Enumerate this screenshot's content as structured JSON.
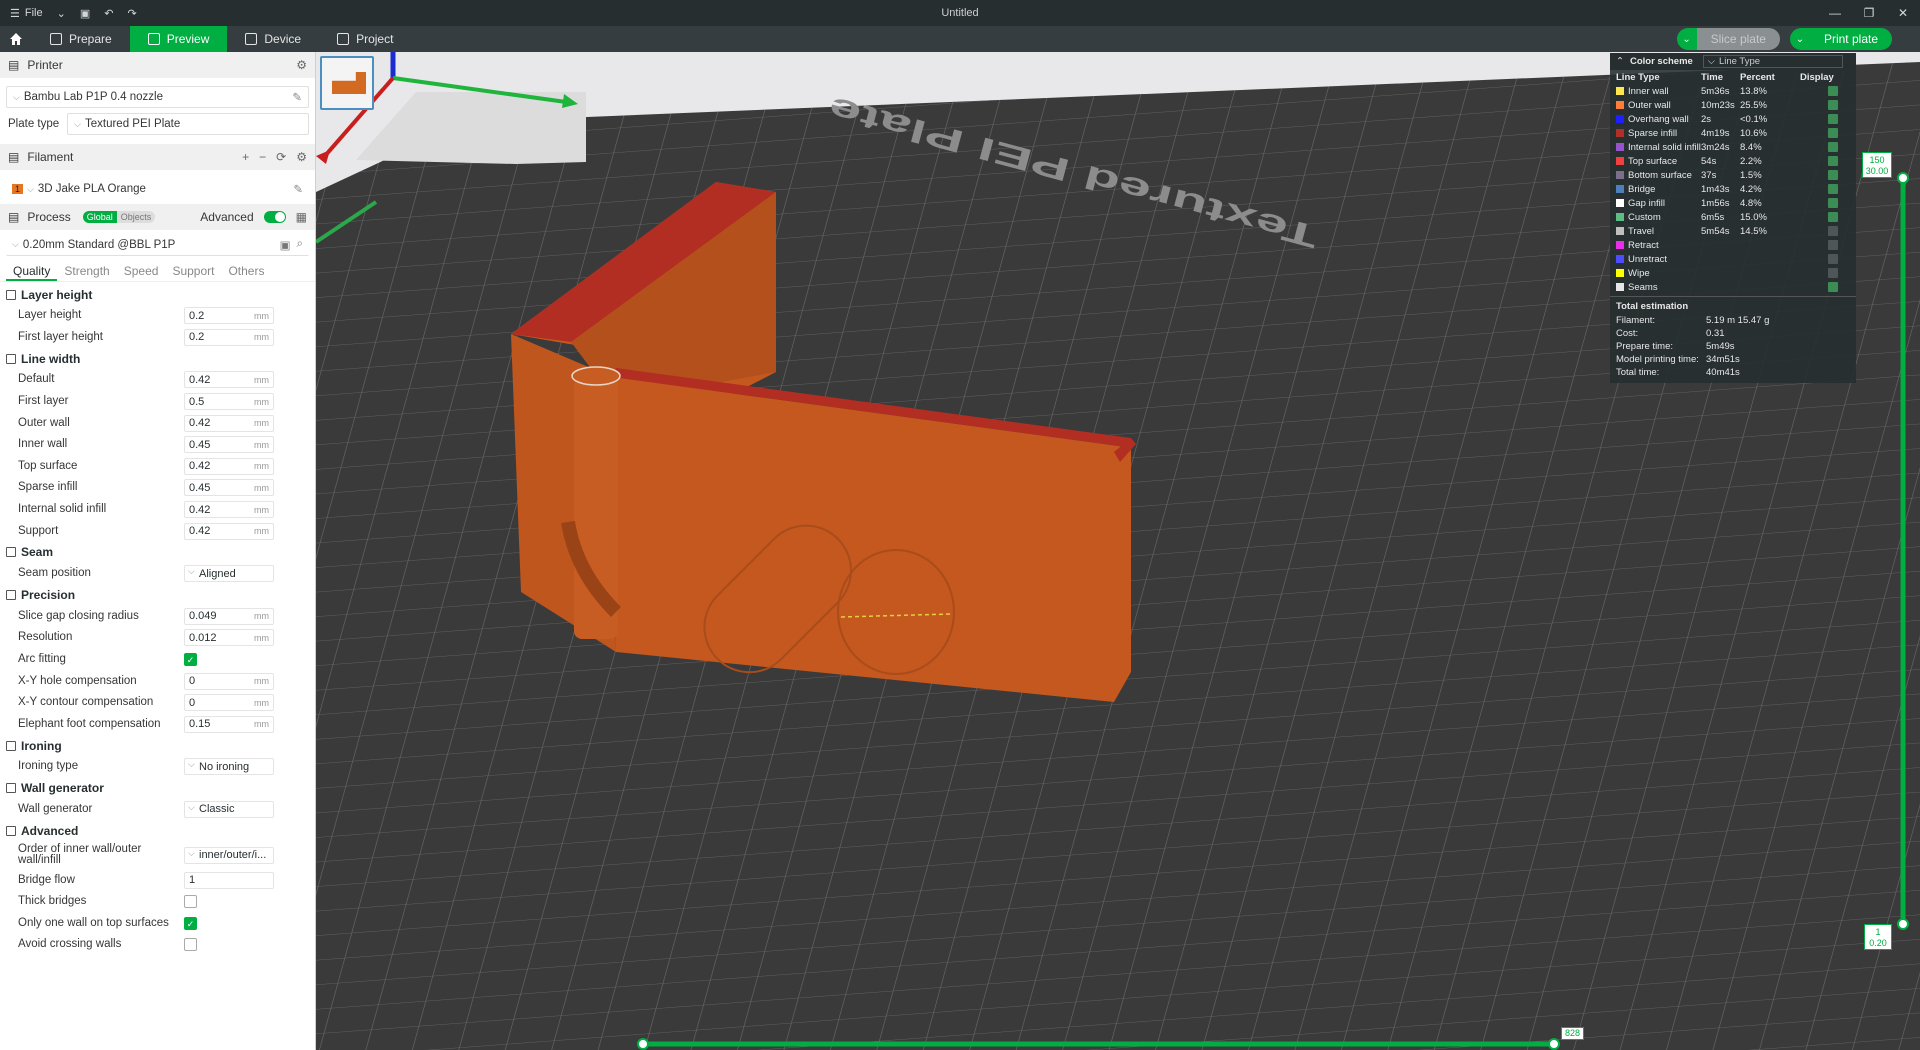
{
  "window": {
    "title": "Untitled",
    "file_label": "File"
  },
  "toolbar": {
    "tabs": [
      {
        "label": "Prepare"
      },
      {
        "label": "Preview"
      },
      {
        "label": "Device"
      },
      {
        "label": "Project"
      }
    ],
    "slice_label": "Slice plate",
    "print_label": "Print plate"
  },
  "printer": {
    "section_label": "Printer",
    "printer_name": "Bambu Lab P1P 0.4 nozzle",
    "plate_type_label": "Plate type",
    "plate_type_value": "Textured PEI Plate"
  },
  "filament": {
    "section_label": "Filament",
    "slot": "1",
    "name": "3D Jake PLA Orange"
  },
  "process": {
    "section_label": "Process",
    "toggle_global": "Global",
    "toggle_objects": "Objects",
    "advanced_label": "Advanced",
    "profile": "0.20mm Standard @BBL P1P",
    "subtabs": [
      "Quality",
      "Strength",
      "Speed",
      "Support",
      "Others"
    ]
  },
  "groups": {
    "layer_height": {
      "title": "Layer height",
      "rows": [
        {
          "label": "Layer height",
          "value": "0.2",
          "unit": "mm"
        },
        {
          "label": "First layer height",
          "value": "0.2",
          "unit": "mm"
        }
      ]
    },
    "line_width": {
      "title": "Line width",
      "rows": [
        {
          "label": "Default",
          "value": "0.42",
          "unit": "mm"
        },
        {
          "label": "First layer",
          "value": "0.5",
          "unit": "mm"
        },
        {
          "label": "Outer wall",
          "value": "0.42",
          "unit": "mm"
        },
        {
          "label": "Inner wall",
          "value": "0.45",
          "unit": "mm"
        },
        {
          "label": "Top surface",
          "value": "0.42",
          "unit": "mm"
        },
        {
          "label": "Sparse infill",
          "value": "0.45",
          "unit": "mm"
        },
        {
          "label": "Internal solid infill",
          "value": "0.42",
          "unit": "mm"
        },
        {
          "label": "Support",
          "value": "0.42",
          "unit": "mm"
        }
      ]
    },
    "seam": {
      "title": "Seam",
      "rows": [
        {
          "label": "Seam position",
          "value": "Aligned"
        }
      ]
    },
    "precision": {
      "title": "Precision",
      "rows": [
        {
          "label": "Slice gap closing radius",
          "value": "0.049",
          "unit": "mm"
        },
        {
          "label": "Resolution",
          "value": "0.012",
          "unit": "mm"
        },
        {
          "label": "Arc fitting",
          "checked": true
        },
        {
          "label": "X-Y hole compensation",
          "value": "0",
          "unit": "mm"
        },
        {
          "label": "X-Y contour compensation",
          "value": "0",
          "unit": "mm"
        },
        {
          "label": "Elephant foot compensation",
          "value": "0.15",
          "unit": "mm"
        }
      ]
    },
    "ironing": {
      "title": "Ironing",
      "rows": [
        {
          "label": "Ironing type",
          "value": "No ironing"
        }
      ]
    },
    "wall_generator": {
      "title": "Wall generator",
      "rows": [
        {
          "label": "Wall generator",
          "value": "Classic"
        }
      ]
    },
    "advanced": {
      "title": "Advanced",
      "rows": [
        {
          "label": "Order of inner wall/outer wall/infill",
          "value": "inner/outer/i..."
        },
        {
          "label": "Bridge flow",
          "value": "1"
        },
        {
          "label": "Thick bridges",
          "checked": false
        },
        {
          "label": "Only one wall on top surfaces",
          "checked": true
        },
        {
          "label": "Avoid crossing walls",
          "checked": false
        }
      ]
    }
  },
  "viewport": {
    "bed_text": "Textured PEI Plate",
    "h_slider_value": "828",
    "v_slider_top_layer": "150",
    "v_slider_top_height": "30.00",
    "v_slider_bottom_layer": "1",
    "v_slider_bottom_height": "0.20",
    "model_color": "#c4581f",
    "top_color": "#b22d22"
  },
  "legend": {
    "color_scheme_label": "Color scheme",
    "scheme_value": "Line Type",
    "col_type": "Line Type",
    "col_time": "Time",
    "col_percent": "Percent",
    "col_display": "Display",
    "rows": [
      {
        "name": "Inner wall",
        "time": "5m36s",
        "percent": "13.8%",
        "color": "#ffe64d",
        "display": true
      },
      {
        "name": "Outer wall",
        "time": "10m23s",
        "percent": "25.5%",
        "color": "#ff7d38",
        "display": true
      },
      {
        "name": "Overhang wall",
        "time": "2s",
        "percent": "<0.1%",
        "color": "#1f1fff",
        "display": true
      },
      {
        "name": "Sparse infill",
        "time": "4m19s",
        "percent": "10.6%",
        "color": "#b03029",
        "display": true
      },
      {
        "name": "Internal solid infill",
        "time": "3m24s",
        "percent": "8.4%",
        "color": "#9654cc",
        "display": true
      },
      {
        "name": "Top surface",
        "time": "54s",
        "percent": "2.2%",
        "color": "#f04040",
        "display": true
      },
      {
        "name": "Bottom surface",
        "time": "37s",
        "percent": "1.5%",
        "color": "#7d6e8a",
        "display": true
      },
      {
        "name": "Bridge",
        "time": "1m43s",
        "percent": "4.2%",
        "color": "#4d80ba",
        "display": true
      },
      {
        "name": "Gap infill",
        "time": "1m56s",
        "percent": "4.8%",
        "color": "#ffffff",
        "display": true
      },
      {
        "name": "Custom",
        "time": "6m5s",
        "percent": "15.0%",
        "color": "#5ebd85",
        "display": true
      },
      {
        "name": "Travel",
        "time": "5m54s",
        "percent": "14.5%",
        "color": "#bfbfbf",
        "display": false
      },
      {
        "name": "Retract",
        "time": "",
        "percent": "",
        "color": "#e82ee8",
        "display": false
      },
      {
        "name": "Unretract",
        "time": "",
        "percent": "",
        "color": "#4d4dff",
        "display": false
      },
      {
        "name": "Wipe",
        "time": "",
        "percent": "",
        "color": "#ffff00",
        "display": false
      },
      {
        "name": "Seams",
        "time": "",
        "percent": "",
        "color": "#e6e6e6",
        "display": true
      }
    ],
    "total_title": "Total estimation",
    "totals": [
      {
        "key": "Filament:",
        "value": "5.19 m   15.47 g"
      },
      {
        "key": "Cost:",
        "value": "0.31"
      },
      {
        "key": "Prepare time:",
        "value": "5m49s"
      },
      {
        "key": "Model printing time:",
        "value": "34m51s"
      },
      {
        "key": "Total time:",
        "value": "40m41s"
      }
    ]
  }
}
